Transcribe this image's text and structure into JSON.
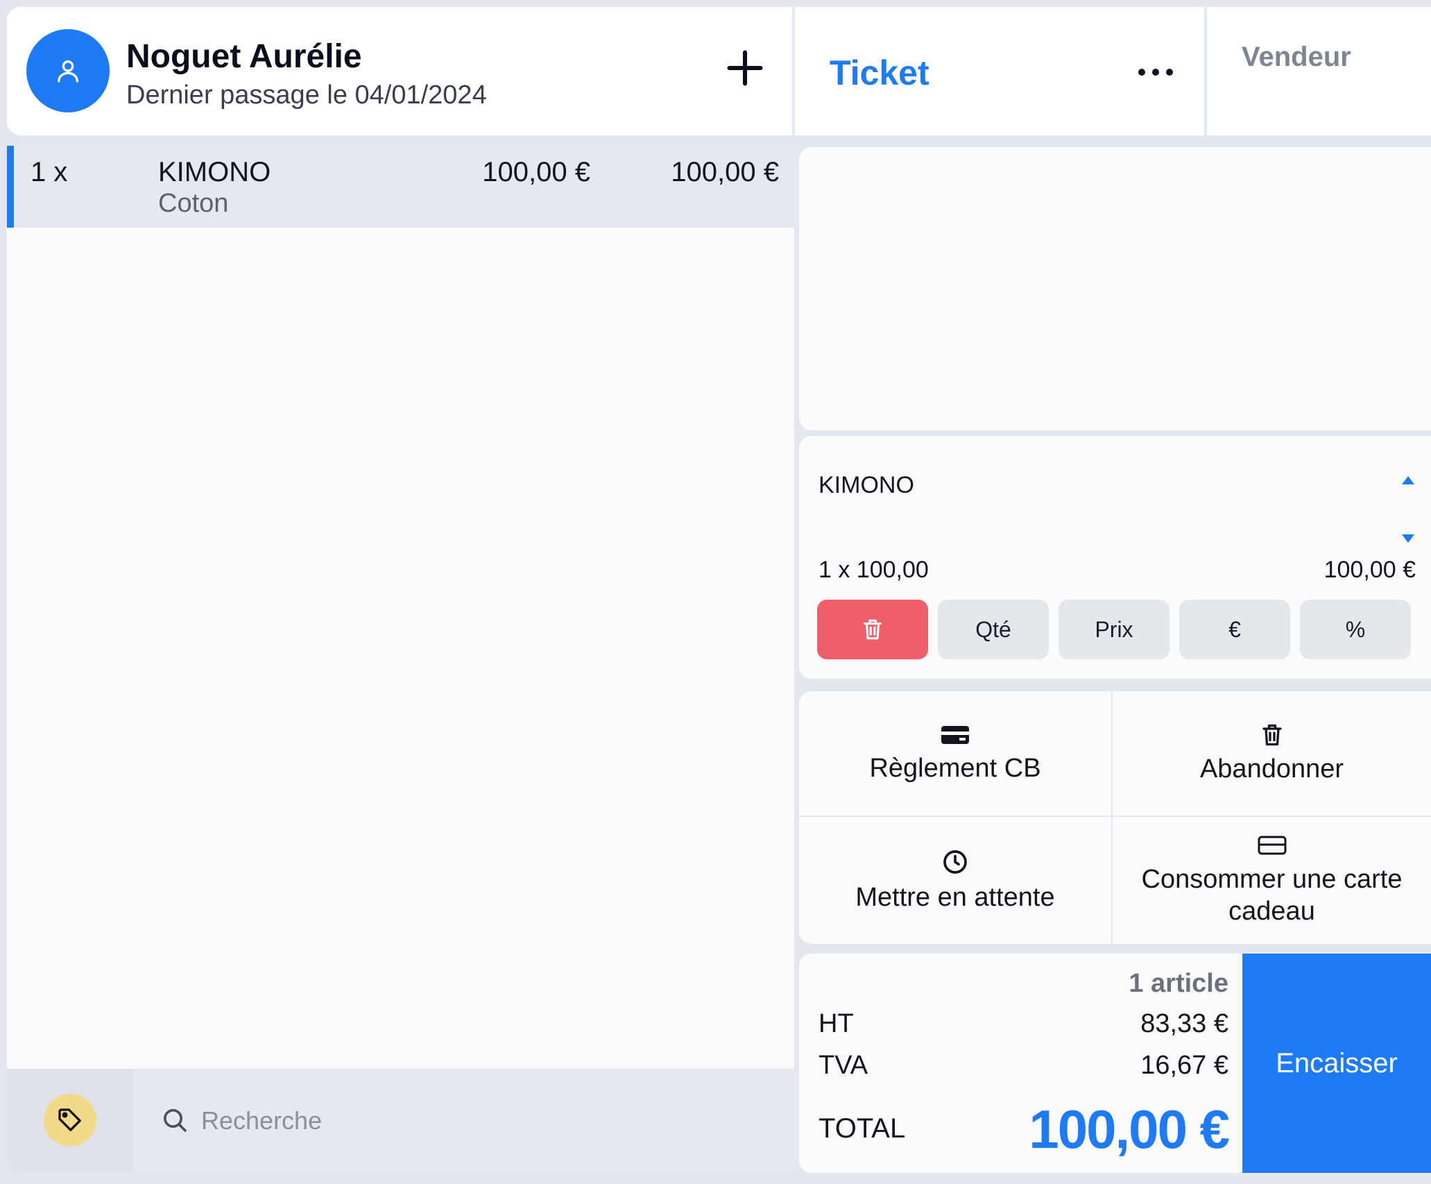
{
  "customer": {
    "name": "Noguet Aurélie",
    "last_visit": "Dernier passage le 04/01/2024"
  },
  "ticket": {
    "title": "Ticket"
  },
  "seller": {
    "title": "Vendeur"
  },
  "cart": {
    "items": [
      {
        "qty": "1 x",
        "name": "KIMONO",
        "variant": "Coton",
        "unit_price": "100,00 €",
        "total": "100,00 €"
      }
    ]
  },
  "search": {
    "placeholder": "Recherche"
  },
  "line_detail": {
    "name": "KIMONO",
    "qty_price": "1 x 100,00",
    "total": "100,00 €",
    "buttons": {
      "qty": "Qté",
      "price": "Prix",
      "euro": "€",
      "percent": "%"
    }
  },
  "actions": {
    "card_payment": "Règlement CB",
    "abandon": "Abandonner",
    "hold": "Mettre en attente",
    "gift_card": "Consommer une carte cadeau"
  },
  "totals": {
    "articles": "1 article",
    "ht_label": "HT",
    "ht_value": "83,33 €",
    "tva_label": "TVA",
    "tva_value": "16,67 €",
    "total_label": "TOTAL",
    "total_value": "100,00 €",
    "checkout": "Encaisser"
  },
  "icons": {
    "avatar": "user-icon",
    "add": "plus-icon",
    "more": "ellipsis-icon",
    "tag": "tag-icon",
    "search": "search-icon",
    "delete": "trash-icon",
    "card": "credit-card-icon",
    "abandon": "trash-icon",
    "hold": "clock-icon",
    "gift": "gift-card-icon"
  },
  "colors": {
    "accent": "#1f7bf5",
    "delete": "#f05e6e",
    "tag": "#f3d98a",
    "background": "#e3e8ee"
  }
}
